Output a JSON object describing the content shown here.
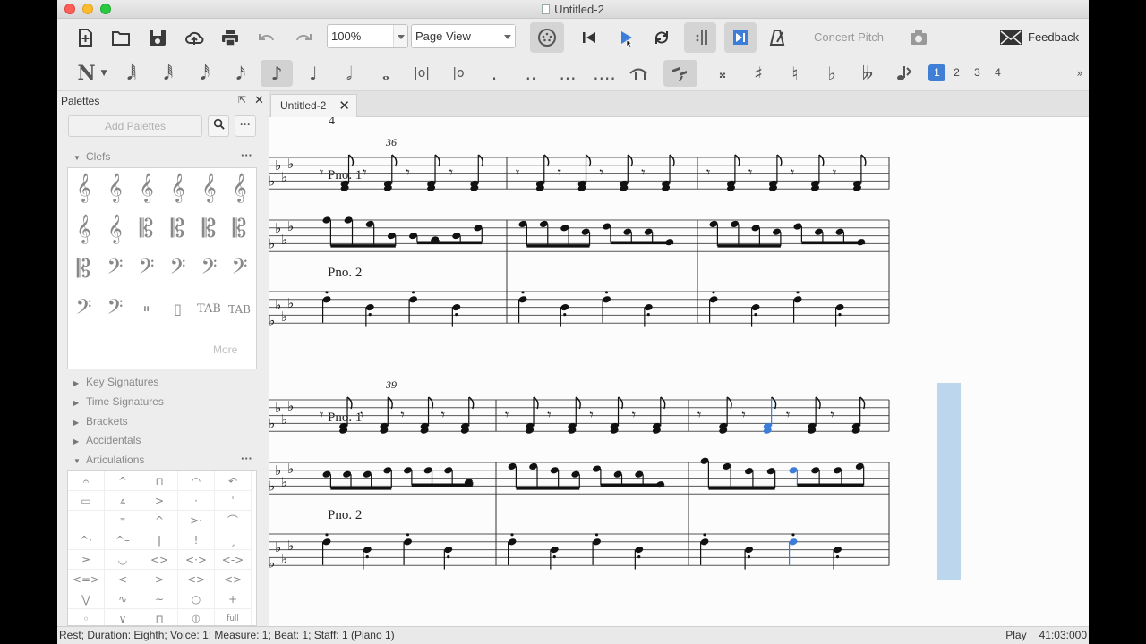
{
  "window": {
    "title": "Untitled-2"
  },
  "toolbar": {
    "zoom_value": "100%",
    "view_mode": "Page View",
    "concert_pitch_label": "Concert Pitch",
    "feedback_label": "Feedback"
  },
  "note_input": {
    "voices": [
      "1",
      "2",
      "3",
      "4"
    ],
    "selected_voice": "1"
  },
  "palettes": {
    "title": "Palettes",
    "add_palettes_label": "Add Palettes",
    "sections": [
      {
        "label": "Clefs",
        "expanded": true
      },
      {
        "label": "Key Signatures",
        "expanded": false
      },
      {
        "label": "Time Signatures",
        "expanded": false
      },
      {
        "label": "Brackets",
        "expanded": false
      },
      {
        "label": "Accidentals",
        "expanded": false
      },
      {
        "label": "Articulations",
        "expanded": true
      }
    ],
    "clefs_more_label": "More"
  },
  "tab": {
    "label": "Untitled-2"
  },
  "score": {
    "systems": [
      {
        "measure_number": "36",
        "staff_labels": [
          "Pno. 1",
          "Pno. 2"
        ]
      },
      {
        "measure_number": "39",
        "staff_labels": [
          "Pno. 1",
          "Pno. 2"
        ]
      }
    ]
  },
  "status": {
    "message": "Rest; Duration: Eighth; Voice: 1;  Measure: 1; Beat: 1; Staff: 1 (Piano 1)",
    "state": "Play",
    "time": "41:03:000"
  },
  "colors": {
    "selection": "#bcd6ee",
    "playhead_note": "#3b7dd8",
    "voice_selected": "#3f7fd6"
  }
}
